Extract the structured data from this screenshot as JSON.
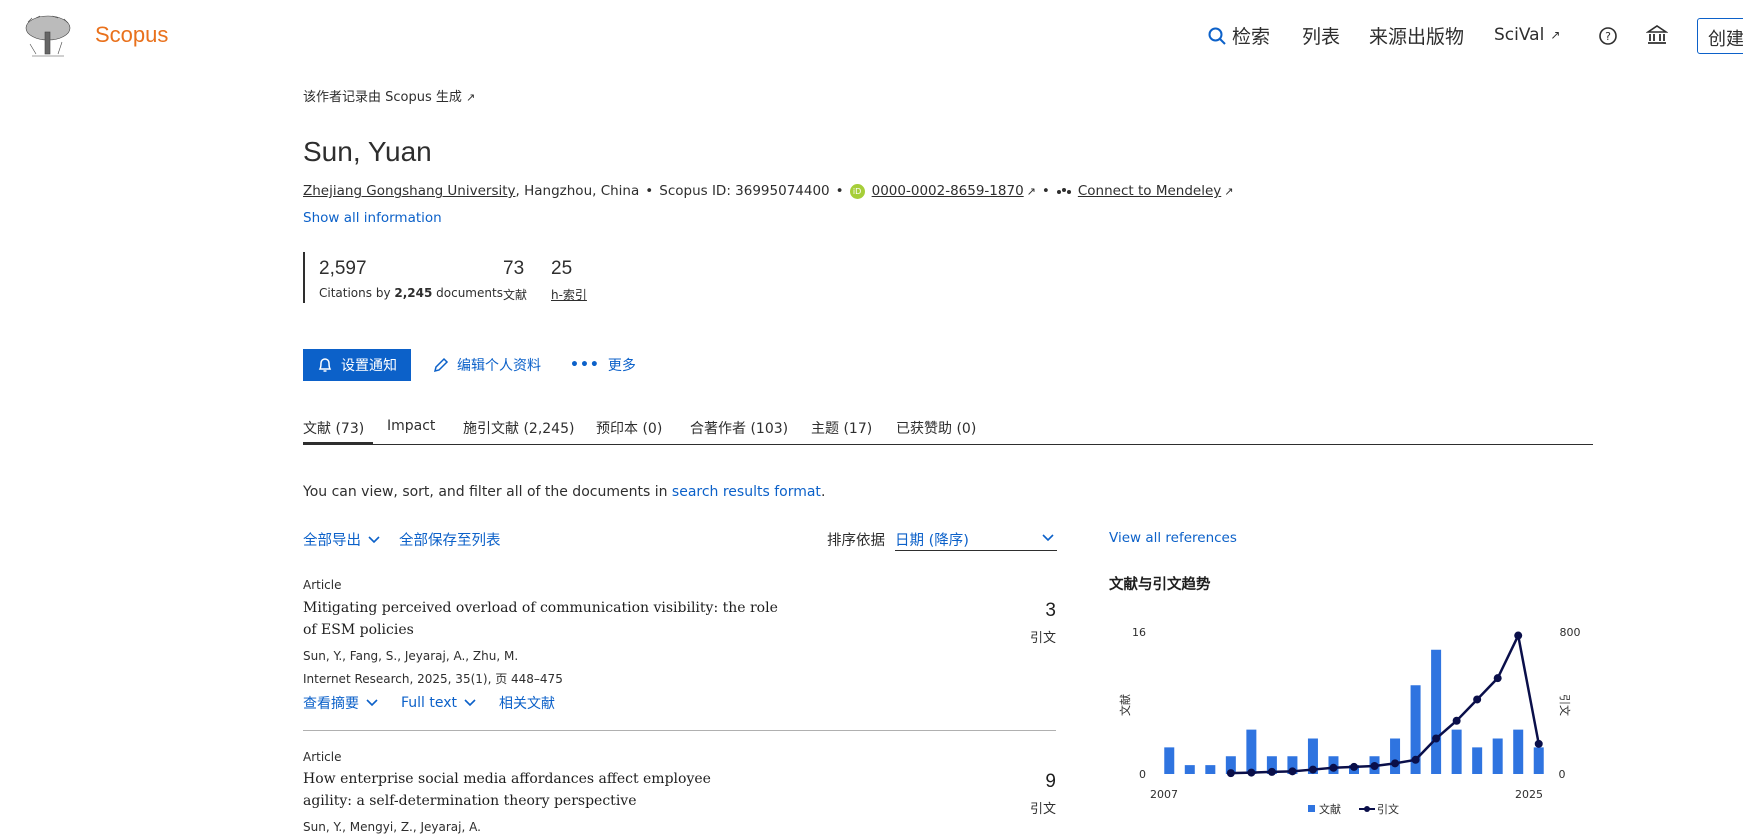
{
  "header": {
    "logo_text": "Scopus",
    "nav_search": "检索",
    "nav_lists": "列表",
    "nav_sources": "来源出版物",
    "nav_scival": "SciVal",
    "nav_create": "创建",
    "icons": [
      "search-icon",
      "external-link-icon",
      "help-icon",
      "institution-icon"
    ]
  },
  "author": {
    "generated_by": "该作者记录由 Scopus 生成",
    "name": "Sun, Yuan",
    "affiliation": "Zhejiang Gongshang University",
    "location": ", Hangzhou, China",
    "scopus_id": "Scopus ID: 36995074400",
    "orcid": "0000-0002-8659-1870",
    "mendeley": "Connect to Mendeley",
    "show_all": "Show all information"
  },
  "metrics": {
    "citations_value": "2,597",
    "citations_label_pre": "Citations by ",
    "citations_docs": "2,245",
    "citations_label_post": " documents",
    "documents_value": "73",
    "documents_label": "文献",
    "hindex_value": "25",
    "hindex_label": "h-索引"
  },
  "actions": {
    "alert": "设置通知",
    "edit": "编辑个人资料",
    "more": "更多"
  },
  "tabs": [
    {
      "label": "文献 (73)",
      "active": true
    },
    {
      "label": "Impact",
      "active": false
    },
    {
      "label": "施引文献 (2,245)",
      "active": false
    },
    {
      "label": "预印本 (0)",
      "active": false
    },
    {
      "label": "合著作者 (103)",
      "active": false
    },
    {
      "label": "主题 (17)",
      "active": false
    },
    {
      "label": "已获赞助 (0)",
      "active": false
    }
  ],
  "docs_panel": {
    "note_pre": "You can view, sort, and filter all of the documents in ",
    "note_link": "search results format",
    "note_post": ".",
    "export_all": "全部导出",
    "save_all": "全部保存至列表",
    "sort_label": "排序依据",
    "sort_value": "日期 (降序)"
  },
  "documents": [
    {
      "type": "Article",
      "title": "Mitigating perceived overload of communication visibility: the role of ESM policies",
      "authors": "Sun, Y., Fang, S., Jeyaraj, A., Zhu, M.",
      "source": "Internet Research, 2025, 35(1), 页 448–475",
      "citations": "3",
      "citations_label": "引文",
      "link_abstract": "查看摘要",
      "link_fulltext": "Full text",
      "link_related": "相关文献"
    },
    {
      "type": "Article",
      "title": "How enterprise social media affordances affect employee agility: a self-determination theory perspective",
      "authors": "Sun, Y., Mengyi, Z., Jeyaraj, A.",
      "citations": "9",
      "citations_label": "引文"
    }
  ],
  "chart_panel": {
    "view_refs": "View all references",
    "title": "文献与引文趋势"
  },
  "chart_data": {
    "type": "bar",
    "title": "文献与引文趋势",
    "x_start_label": "2007",
    "x_end_label": "2025",
    "years": [
      2007,
      2008,
      2009,
      2010,
      2011,
      2012,
      2013,
      2014,
      2015,
      2016,
      2017,
      2018,
      2019,
      2020,
      2021,
      2022,
      2023,
      2024,
      2025
    ],
    "left_axis": {
      "label": "文献",
      "min": 0,
      "max": 16,
      "ticks": [
        "0",
        "16"
      ]
    },
    "right_axis": {
      "label": "引文",
      "min": 0,
      "max": 800,
      "ticks": [
        "0",
        "800"
      ]
    },
    "series": [
      {
        "name": "文献",
        "kind": "bar",
        "color": "#2f74e0",
        "values": [
          3,
          1,
          1,
          2,
          5,
          2,
          2,
          4,
          2,
          1,
          2,
          4,
          10,
          14,
          5,
          3,
          4,
          5,
          3
        ]
      },
      {
        "name": "引文",
        "kind": "line",
        "color": "#0a0f4a",
        "values": [
          null,
          null,
          null,
          5,
          8,
          12,
          15,
          25,
          35,
          40,
          45,
          60,
          80,
          200,
          300,
          420,
          540,
          780,
          170
        ]
      }
    ],
    "legend_position": "bottom-center",
    "grid": false
  },
  "colors": {
    "brand": "#e9711c",
    "primary": "#0c61c9",
    "text": "#2e2e2e"
  }
}
